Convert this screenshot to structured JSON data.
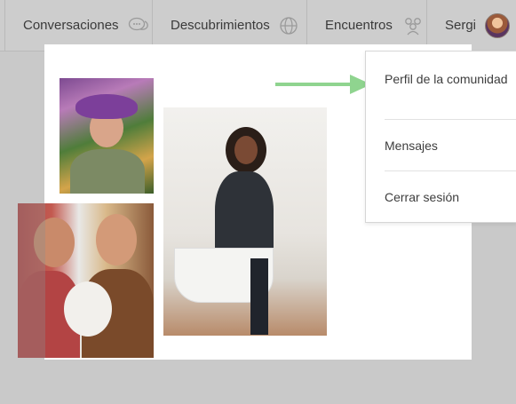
{
  "nav": {
    "conversaciones": "Conversaciones",
    "descubrimientos": "Descubrimientos",
    "encuentros": "Encuentros",
    "user_name": "Sergi"
  },
  "icons": {
    "conversaciones": "chat-bubbles-icon",
    "descubrimientos": "globe-icon",
    "encuentros": "group-icon",
    "avatar": "user-avatar"
  },
  "menu": {
    "profile": "Perfil de la comunidad",
    "messages": "Mensajes",
    "logout": "Cerrar sesión"
  },
  "colors": {
    "arrow": "#8fd48f",
    "overlay": "#c9c9c9"
  }
}
